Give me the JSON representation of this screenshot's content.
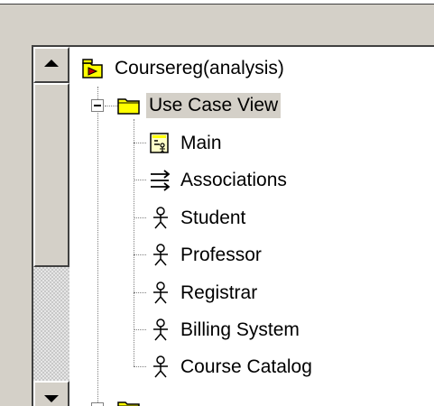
{
  "tree": {
    "root": {
      "label": "Coursereg(analysis)",
      "icon": "model-icon"
    },
    "use_case_view": {
      "label": "Use Case View",
      "icon": "folder-icon",
      "state": "expanded"
    },
    "children": [
      {
        "label": "Main",
        "icon": "diagram-icon"
      },
      {
        "label": "Associations",
        "icon": "associations-icon"
      },
      {
        "label": "Student",
        "icon": "actor-icon"
      },
      {
        "label": "Professor",
        "icon": "actor-icon"
      },
      {
        "label": "Registrar",
        "icon": "actor-icon"
      },
      {
        "label": "Billing System",
        "icon": "actor-icon"
      },
      {
        "label": "Course Catalog",
        "icon": "actor-icon"
      }
    ]
  },
  "colors": {
    "panel_bg": "#ffffff",
    "chrome_bg": "#d4d0c8",
    "selection_bg": "#d4d0c8",
    "folder_yellow": "#ffff00"
  }
}
